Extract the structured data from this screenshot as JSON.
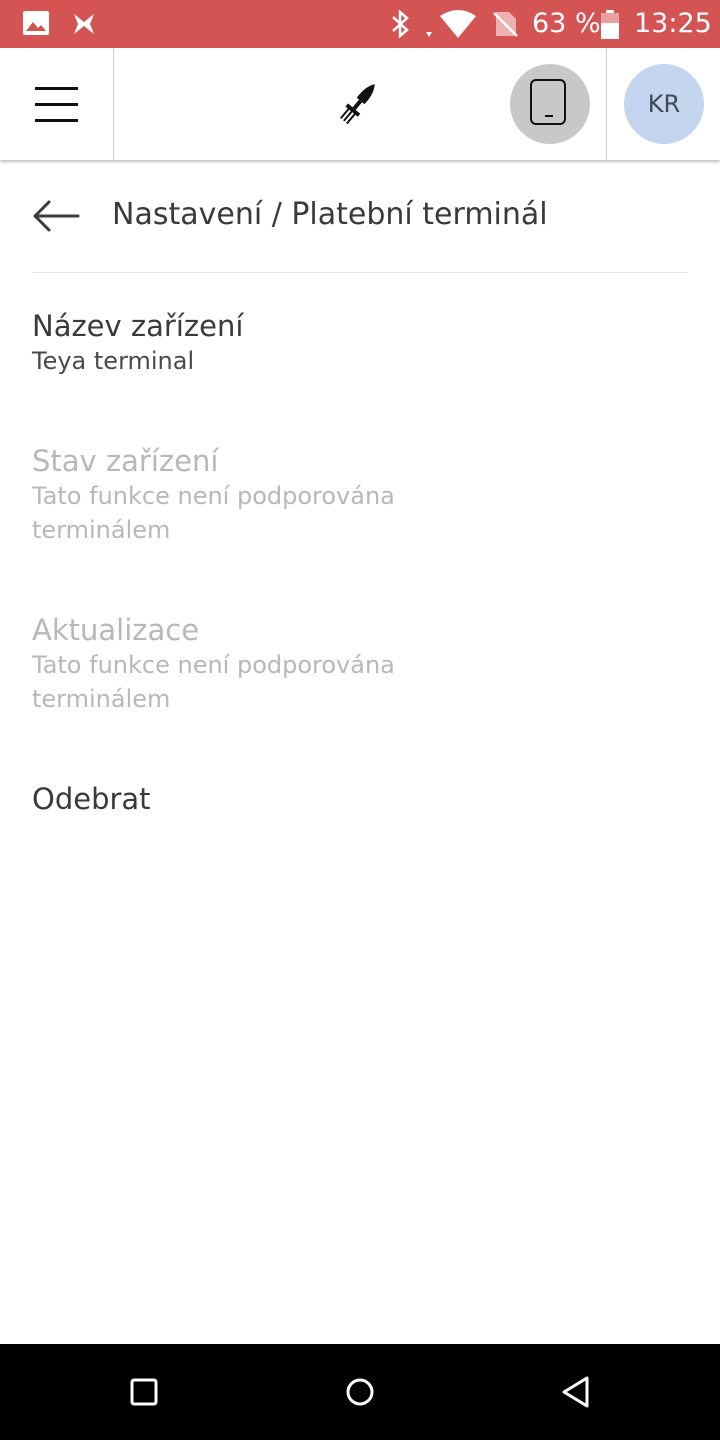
{
  "status_bar": {
    "battery_percent": "63 %",
    "time": "13:25",
    "background_color": "#d45454",
    "icons": [
      "image-icon",
      "app-notification-icon",
      "bluetooth-icon",
      "wifi-icon",
      "no-sim-icon",
      "battery-icon"
    ]
  },
  "app_bar": {
    "menu_icon": "hamburger-menu-icon",
    "logo_icon": "rocket-fork-logo-icon",
    "device_icon": "tablet-icon",
    "avatar_initials": "KR",
    "avatar_color": "#c4d6ef"
  },
  "page": {
    "back_icon": "arrow-left-icon",
    "title": "Nastavení / Platební terminál"
  },
  "settings": [
    {
      "label": "Název zařízení",
      "value": "Teya terminal",
      "enabled": true
    },
    {
      "label": "Stav zařízení",
      "value": "Tato funkce není podporována terminálem",
      "enabled": false
    },
    {
      "label": "Aktualizace",
      "value": "Tato funkce není podporována terminálem",
      "enabled": false
    },
    {
      "label": "Odebrat",
      "value": "",
      "enabled": true
    }
  ],
  "nav_bar": {
    "buttons": [
      "recents-square-icon",
      "home-circle-icon",
      "back-triangle-icon"
    ]
  }
}
